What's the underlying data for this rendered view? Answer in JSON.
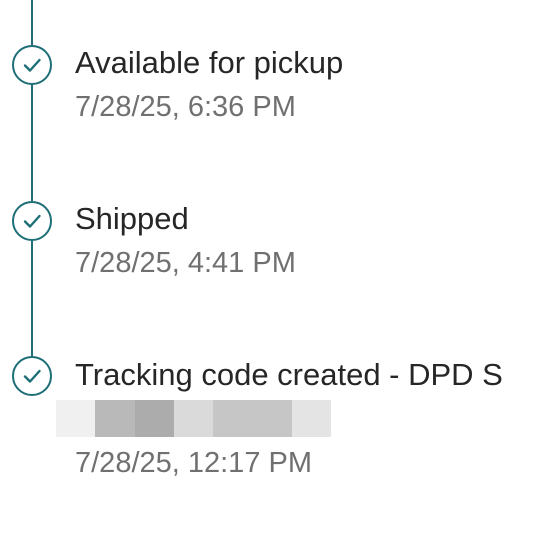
{
  "events": [
    {
      "title": "Available for pickup",
      "time": "7/28/25, 6:36 PM",
      "status": "completed"
    },
    {
      "title": "Shipped",
      "time": "7/28/25, 4:41 PM",
      "status": "completed"
    },
    {
      "title": "Tracking code created - DPD S",
      "time": "7/28/25, 12:17 PM",
      "status": "completed"
    }
  ],
  "icons": {
    "event_status": "check-circle-icon"
  },
  "colors": {
    "accent": "#1f6f78",
    "title_text": "#262626",
    "time_text": "#707070",
    "redaction": [
      "#f0f0f0",
      "#b9b9b9",
      "#acacac",
      "#dadada",
      "#c6c6c6",
      "#e4e4e4"
    ]
  }
}
